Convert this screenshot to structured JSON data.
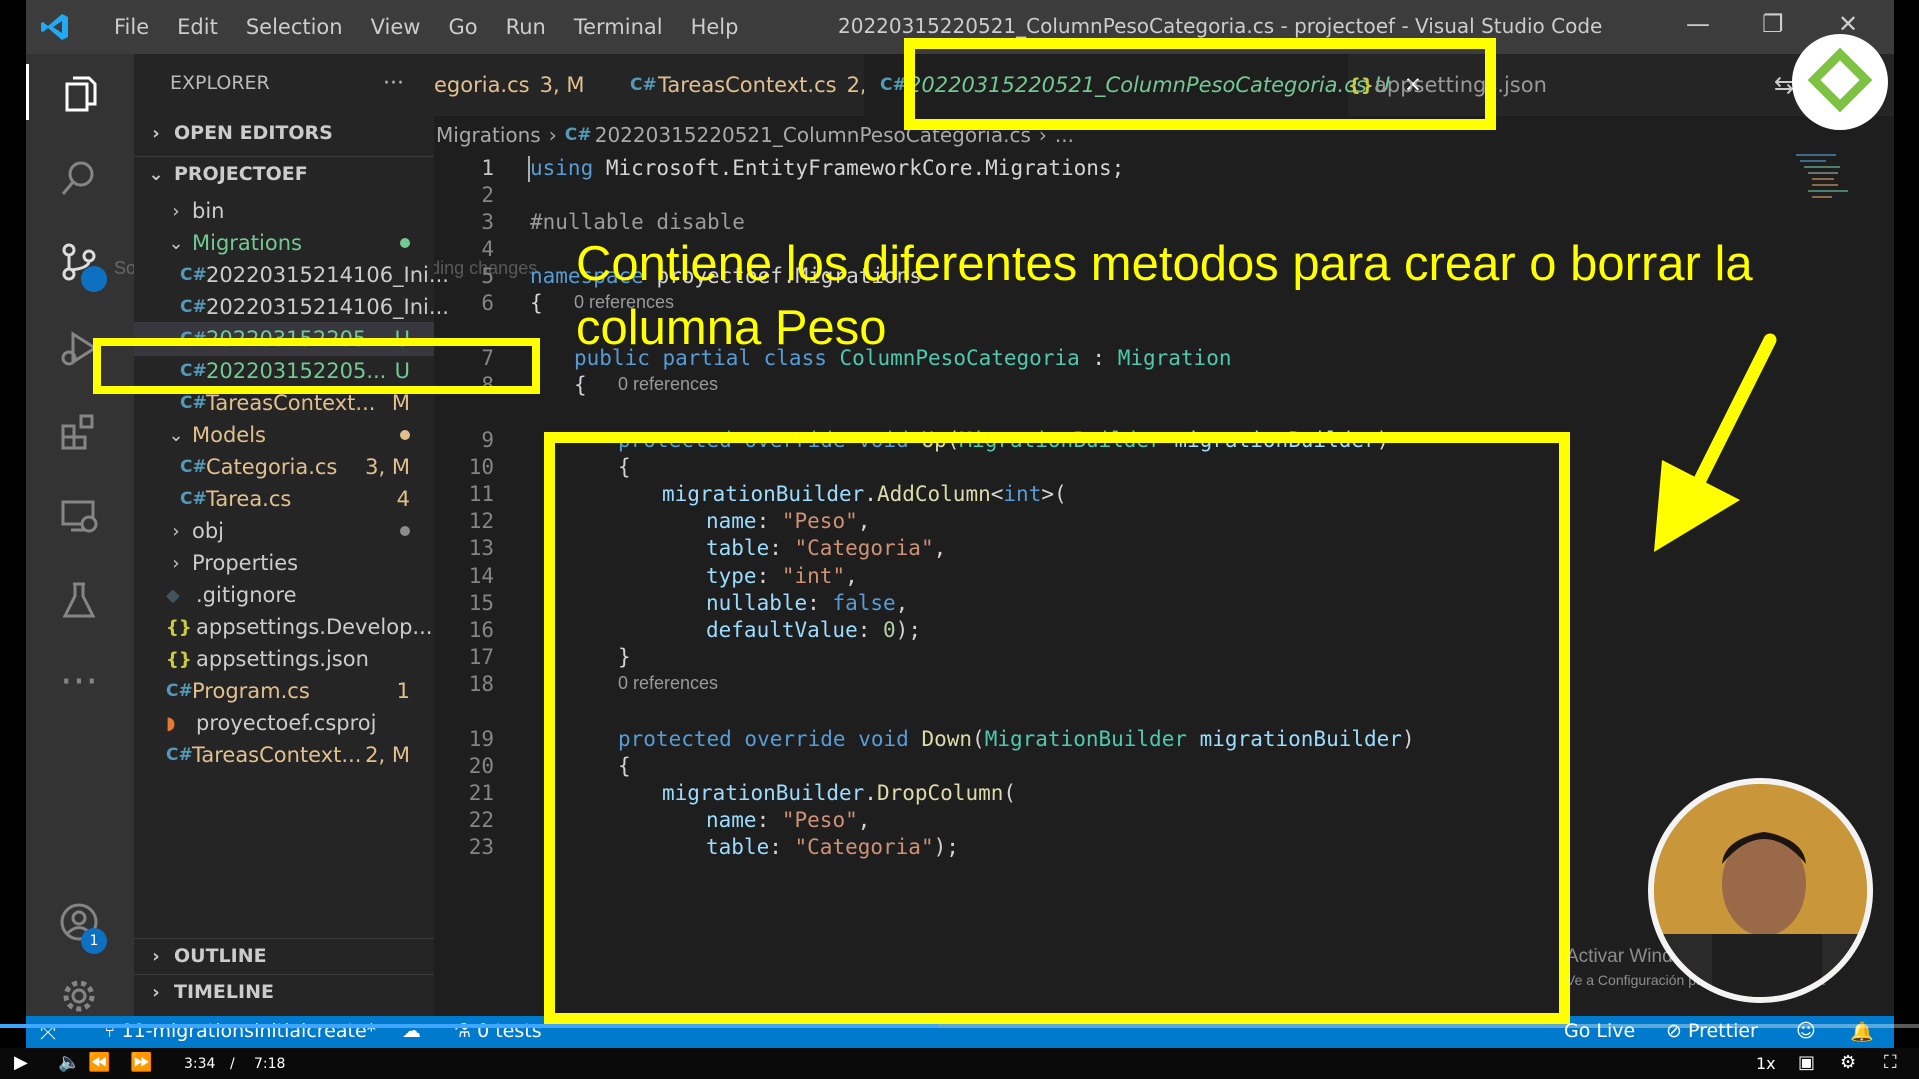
{
  "titlebar": {
    "menu": [
      "File",
      "Edit",
      "Selection",
      "View",
      "Go",
      "Run",
      "Terminal",
      "Help"
    ],
    "title": "20220315220521_ColumnPesoCategoria.cs - projectoef - Visual Studio Code"
  },
  "activity_bar": {
    "tooltip": "Source Control (Ctrl+Shift+G G) - 6 pending changes",
    "accounts_badge": "1"
  },
  "explorer": {
    "title": "EXPLORER",
    "more": "···",
    "open_editors": "OPEN EDITORS",
    "project": "PROJECTOEF",
    "items": [
      {
        "label": "bin",
        "status": ""
      },
      {
        "label": "Migrations",
        "status": ""
      },
      {
        "label": "20220315214106_Ini...",
        "status": ""
      },
      {
        "label": "20220315214106_Ini...",
        "status": ""
      },
      {
        "label": "202203152205...",
        "status": "U"
      },
      {
        "label": "202203152205...",
        "status": "U"
      },
      {
        "label": "TareasContext...",
        "status": "M"
      },
      {
        "label": "Models",
        "status": ""
      },
      {
        "label": "Categoria.cs",
        "status": "3, M"
      },
      {
        "label": "Tarea.cs",
        "status": "4"
      },
      {
        "label": "obj",
        "status": ""
      },
      {
        "label": "Properties",
        "status": ""
      },
      {
        "label": ".gitignore",
        "status": ""
      },
      {
        "label": "appsettings.Develop...",
        "status": ""
      },
      {
        "label": "appsettings.json",
        "status": ""
      },
      {
        "label": "Program.cs",
        "status": "1"
      },
      {
        "label": "proyectoef.csproj",
        "status": ""
      },
      {
        "label": "TareasContext...",
        "status": "2, M"
      }
    ],
    "outline": "OUTLINE",
    "timeline": "TIMELINE"
  },
  "tabs": [
    {
      "label": "egoria.cs",
      "status": "3, M"
    },
    {
      "label": "TareasContext.cs",
      "status": "2, M"
    },
    {
      "label": "20220315220521_ColumnPesoCategoria.cs",
      "status": "U",
      "close": "✕"
    },
    {
      "label": "appsettings.json",
      "status": ""
    }
  ],
  "breadcrumb": {
    "folder": "Migrations",
    "file": "20220315220521_ColumnPesoCategoria.cs",
    "more": "..."
  },
  "editor": {
    "line_numbers": [
      "1",
      "2",
      "3",
      "4",
      "5",
      "6",
      "7",
      "8",
      "9",
      "10",
      "11",
      "12",
      "13",
      "14",
      "15",
      "16",
      "17",
      "18",
      "19",
      "20",
      "21",
      "22",
      "23"
    ],
    "codelens": "0 references",
    "code": {
      "l1_kw": "using",
      "l1_rest": " Microsoft.EntityFrameworkCore.Migrations;",
      "l3": "#nullable disable",
      "l5_kw": "namespace",
      "l5_rest": " proyectoef.Migrations",
      "l6": "{",
      "l7_kw": "public partial class",
      "l7_cls": "ColumnPesoCategoria",
      "l7_colon": " : ",
      "l7_base": "Migration",
      "l8": "{",
      "l9_kw": "protected override void",
      "l9_fn": "Up",
      "l9_open": "(",
      "l9_type": "MigrationBuilder",
      "l9_param": "migrationBuilder",
      "l9_close": ")",
      "l10": "{",
      "l11_var": "migrationBuilder",
      "l11_dot": ".",
      "l11_fn": "AddColumn",
      "l11_lt": "<",
      "l11_kw": "int",
      "l11_gt": ">(",
      "l12_name": "name",
      "l12_val": "\"Peso\"",
      "l13_name": "table",
      "l13_val": "\"Categoria\"",
      "l14_name": "type",
      "l14_val": "\"int\"",
      "l15_name": "nullable",
      "l15_val": "false",
      "l16_name": "defaultValue",
      "l16_val": "0",
      "l16_end": ");",
      "l17": "}",
      "l19_kw": "protected override void",
      "l19_fn": "Down",
      "l19_open": "(",
      "l19_type": "MigrationBuilder",
      "l19_param": "migrationBuilder",
      "l19_close": ")",
      "l20": "{",
      "l21_var": "migrationBuilder",
      "l21_dot": ".",
      "l21_fn": "DropColumn",
      "l21_open": "(",
      "l22_name": "name",
      "l22_val": "\"Peso\"",
      "l23_name": "table",
      "l23_val": "\"Categoria\"",
      "l23_end": ");"
    }
  },
  "statusbar": {
    "branch": "11-migrationsinitialcreate*",
    "tests": "0 tests",
    "golive": "Go Live",
    "prettier": "Prettier"
  },
  "video": {
    "current": "3:34",
    "separator": "/",
    "duration": "7:18",
    "speed": "1x",
    "progress": 0.4886
  },
  "overlay": {
    "annotation": "Contiene los diferentes metodos para crear o borrar la\ncolumna Peso",
    "watermark_line1": "Activar Windows",
    "watermark_line2": "Ve a Configuración para activar Windows."
  },
  "colors": {
    "highlight": "#ffff00",
    "statusbar": "#007acc",
    "editor_bg": "#1e1e1e",
    "sidebar_bg": "#252526"
  }
}
